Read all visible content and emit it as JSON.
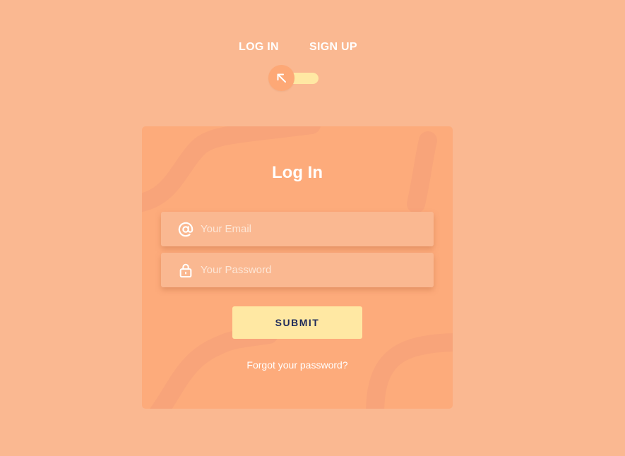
{
  "tabs": {
    "login_label": "LOG IN",
    "signup_label": "SIGN UP"
  },
  "toggle": {
    "state": "log-in",
    "icon": "arrow-up-left-icon"
  },
  "card": {
    "title": "Log In",
    "email": {
      "placeholder": "Your Email",
      "value": "",
      "icon": "at-sign-icon"
    },
    "password": {
      "placeholder": "Your Password",
      "value": "",
      "icon": "lock-icon"
    },
    "submit_label": "SUBMIT",
    "forgot_label": "Forgot your password?"
  },
  "colors": {
    "background": "#fab891",
    "card": "#fdab7b",
    "field": "#fab891",
    "accent": "#ffe8a3",
    "button_text": "#1e2a5a"
  }
}
